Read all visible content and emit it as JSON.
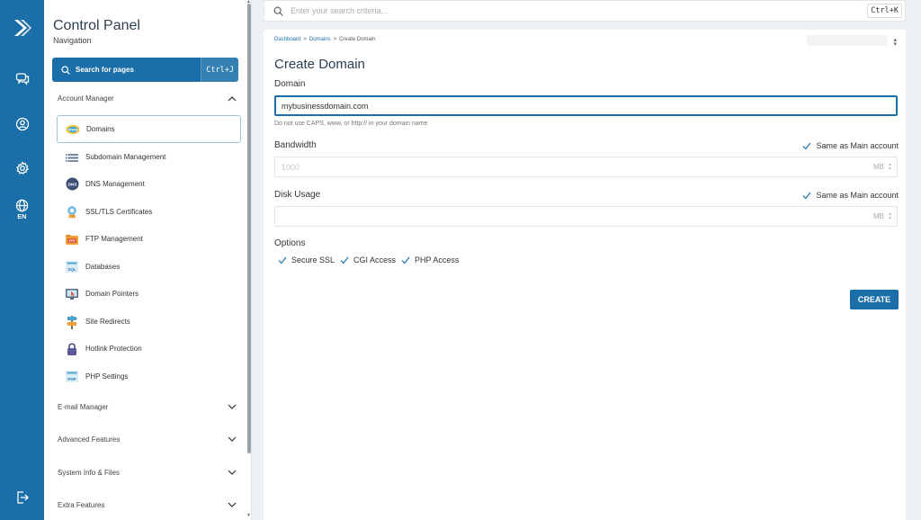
{
  "rail": {
    "language": "EN"
  },
  "nav": {
    "title": "Control Panel",
    "subtitle": "Navigation",
    "search_label": "Search for pages",
    "search_shortcut": "Ctrl+J",
    "account_manager": "Account Manager",
    "items": [
      {
        "label": "Domains",
        "icon": "domains-icon"
      },
      {
        "label": "Subdomain Management",
        "icon": "subdomain-icon"
      },
      {
        "label": "DNS Management",
        "icon": "dns-icon"
      },
      {
        "label": "SSL/TLS Certificates",
        "icon": "ssl-certificate-icon"
      },
      {
        "label": "FTP Management",
        "icon": "ftp-icon"
      },
      {
        "label": "Databases",
        "icon": "database-icon"
      },
      {
        "label": "Domain Pointers",
        "icon": "domain-pointer-icon"
      },
      {
        "label": "Site Redirects",
        "icon": "signpost-icon"
      },
      {
        "label": "Hotlink Protection",
        "icon": "lock-icon"
      },
      {
        "label": "PHP Settings",
        "icon": "php-icon"
      }
    ],
    "sections": [
      "E-mail Manager",
      "Advanced Features",
      "System Info & Files",
      "Extra Features"
    ]
  },
  "topbar": {
    "placeholder": "Enter your search criteria...",
    "shortcut": "Ctrl+K"
  },
  "breadcrumb": {
    "dashboard": "Dashboard",
    "sep": ">",
    "domains": "Domains",
    "current": "Create Domain"
  },
  "form": {
    "title": "Create Domain",
    "domain_label": "Domain",
    "domain_value": "mybusinessdomain.com",
    "domain_hint": "Do not use CAPS, www, or http:// in your domain name",
    "bandwidth_label": "Bandwidth",
    "bandwidth_value": "1000",
    "bandwidth_unit": "MB",
    "same_as_main": "Same as Main account",
    "disk_label": "Disk Usage",
    "disk_unit": "MB",
    "options_label": "Options",
    "options": [
      "Secure SSL",
      "CGI Access",
      "PHP Access"
    ],
    "create_button": "CREATE"
  },
  "colors": {
    "accent": "#1a6fa8",
    "background": "#eef1f4"
  }
}
